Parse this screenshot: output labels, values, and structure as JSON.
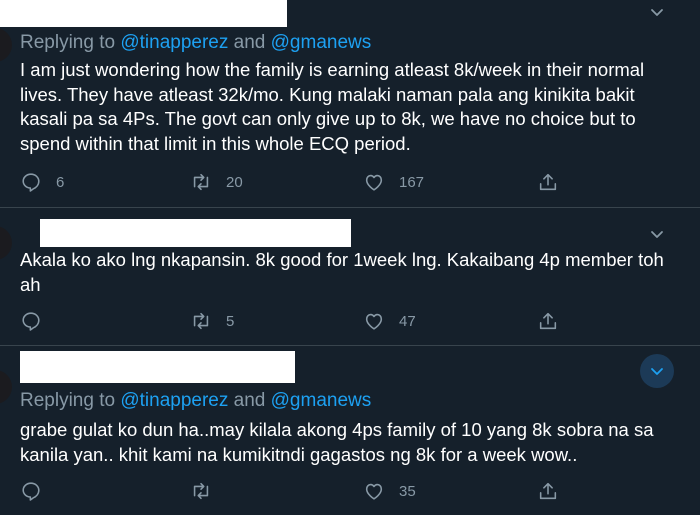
{
  "tweets": [
    {
      "replying_prefix": "Replying to",
      "mention_1": "@tinapperez",
      "and_word": "and",
      "mention_2": "@gmanews",
      "text": "I am just wondering how the family is earning  atleast 8k/week in their normal lives. They have atleast 32k/mo. Kung malaki naman pala ang kinikita bakit kasali pa sa 4Ps. The govt can only give up to 8k, we have no choice but to spend within that limit in this whole ECQ period.",
      "reply_count": "6",
      "retweet_count": "20",
      "like_count": "167"
    },
    {
      "text": "Akala ko ako lng nkapansin. 8k good for 1week lng. Kakaibang 4p member toh ah",
      "reply_count": "",
      "retweet_count": "5",
      "like_count": "47"
    },
    {
      "replying_prefix": "Replying to",
      "mention_1": "@tinapperez",
      "and_word": "and",
      "mention_2": "@gmanews",
      "text": "grabe gulat ko dun ha..may kilala akong 4ps family of 10 yang 8k sobra na sa kanila yan..  khit kami na kumikitndi gagastos ng 8k for a week wow..",
      "reply_count": "",
      "retweet_count": "",
      "like_count": "35"
    }
  ],
  "icons": {
    "reply": "reply-icon",
    "retweet": "retweet-icon",
    "like": "like-icon",
    "share": "share-icon",
    "more": "chevron-down-icon"
  },
  "colors": {
    "background": "#15202b",
    "text": "#ffffff",
    "muted": "#8899a6",
    "accent": "#1da1f2",
    "divider": "#38444d"
  }
}
